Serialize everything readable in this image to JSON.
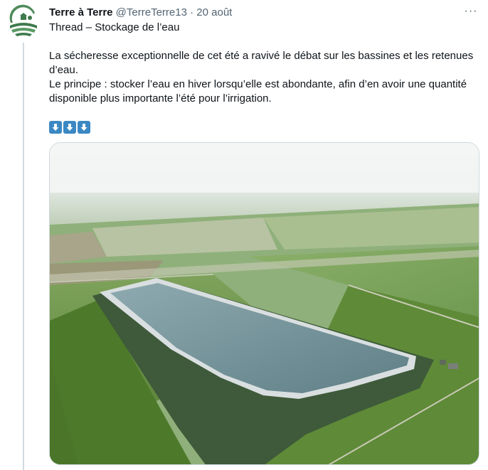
{
  "tweet": {
    "author_name": "Terre à Terre",
    "handle": "@TerreTerre13",
    "separator": "·",
    "date": "20 août",
    "more_label": "···",
    "line1": "Thread – Stockage de l’eau",
    "paragraph1": "La sécheresse exceptionnelle de cet été a ravivé le débat sur les bassines et les retenues d’eau.",
    "paragraph2": "Le principe : stocker l’eau en hiver lorsqu’elle est abondante, afin d’en avoir une quantité disponible plus importante l’été pour l’irrigation.",
    "emoji": [
      "arrow-down-icon",
      "arrow-down-icon",
      "arrow-down-icon"
    ]
  },
  "colors": {
    "emoji_blue": "#3b88c3",
    "logo_green": "#3f7a4d",
    "text_secondary": "#536471"
  }
}
